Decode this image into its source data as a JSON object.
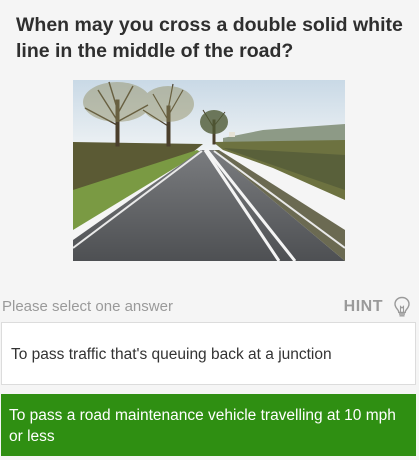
{
  "question": {
    "text": "When may you cross a double solid white line in the middle of the road?"
  },
  "image": {
    "subject": "road-photo",
    "colors": {
      "sky": "#dbe6ee",
      "road": "#5d5f62",
      "lines": "#f4f4f4",
      "grass": "#7a9a43",
      "hedge": "#5b5a34"
    }
  },
  "prompt": {
    "text": "Please select one answer"
  },
  "hint": {
    "label": "HINT",
    "icon": "lightbulb-icon"
  },
  "answers": [
    {
      "text": "To pass traffic that's queuing back at a junction",
      "selected": false
    },
    {
      "text": "To pass a road maintenance vehicle travelling at 10 mph or less",
      "selected": true
    }
  ],
  "colors": {
    "question_text": "#2f2f2f",
    "muted_text": "#9a9a9a",
    "selected_answer_bg": "#2f8f12",
    "answer_bg": "#ffffff"
  }
}
